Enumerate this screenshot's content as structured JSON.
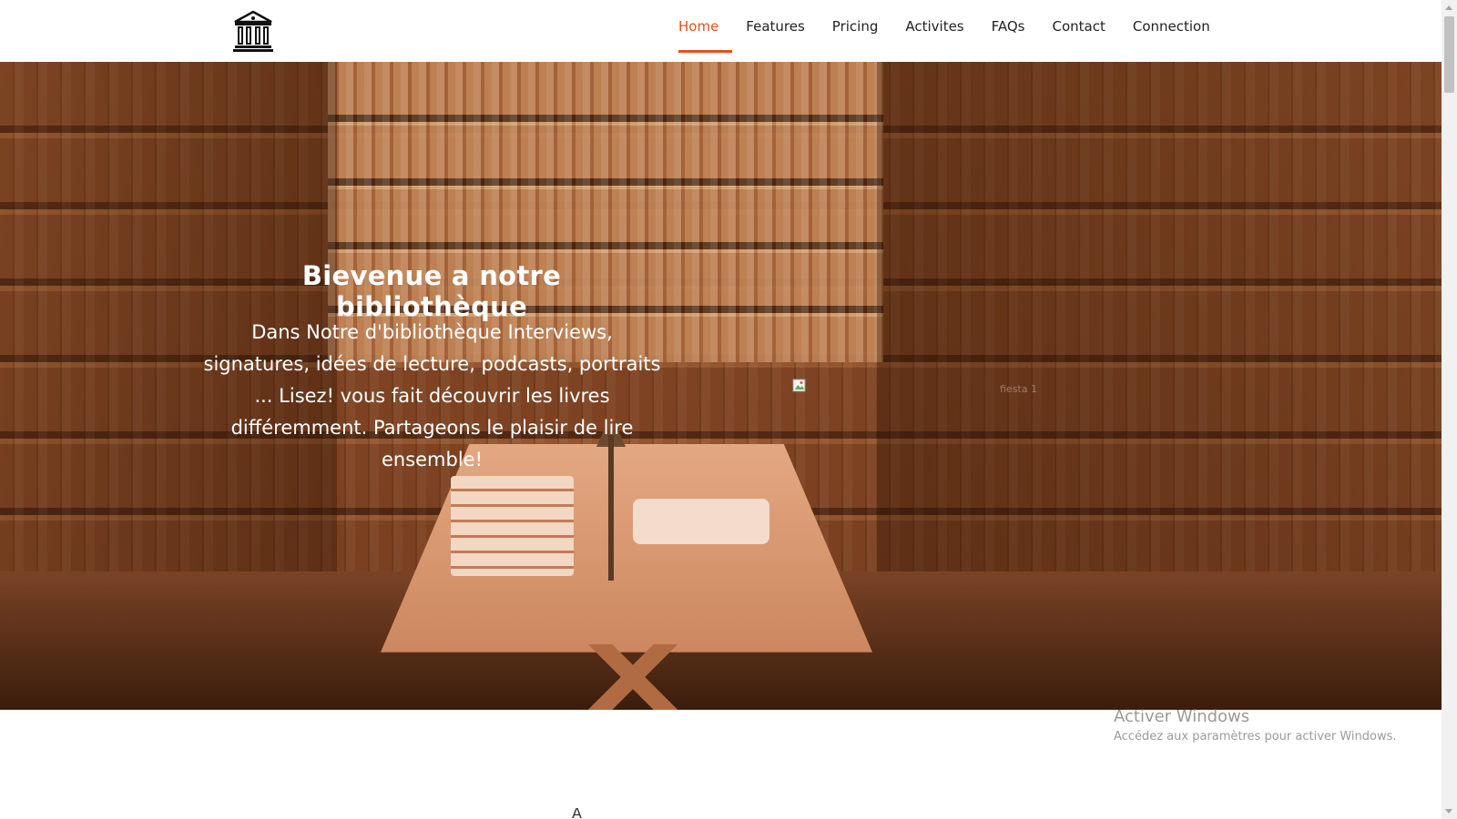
{
  "navbar": {
    "logo_icon": "library-building-icon",
    "items": [
      {
        "label": "Home",
        "active": true
      },
      {
        "label": "Features",
        "active": false
      },
      {
        "label": "Pricing",
        "active": false
      },
      {
        "label": "Activites",
        "active": false
      },
      {
        "label": "FAQs",
        "active": false
      },
      {
        "label": "Contact",
        "active": false
      },
      {
        "label": "Connection",
        "active": false
      }
    ],
    "accent_color": "#e0531b"
  },
  "hero": {
    "title": "Bievenue a notre bibliothèque",
    "text": "Dans Notre d'bibliothèque Interviews, signatures, idées de lecture, podcasts, portraits ... Lisez! vous fait découvrir les livres différemment. Partageons le plaisir de lire ensemble!",
    "image_icon": "broken-image-icon",
    "image_alt": "fiesta 1"
  },
  "watermark": {
    "title": "Activer Windows",
    "subtitle": "Accédez aux paramètres pour activer Windows."
  },
  "below": {
    "glyph": "À"
  }
}
